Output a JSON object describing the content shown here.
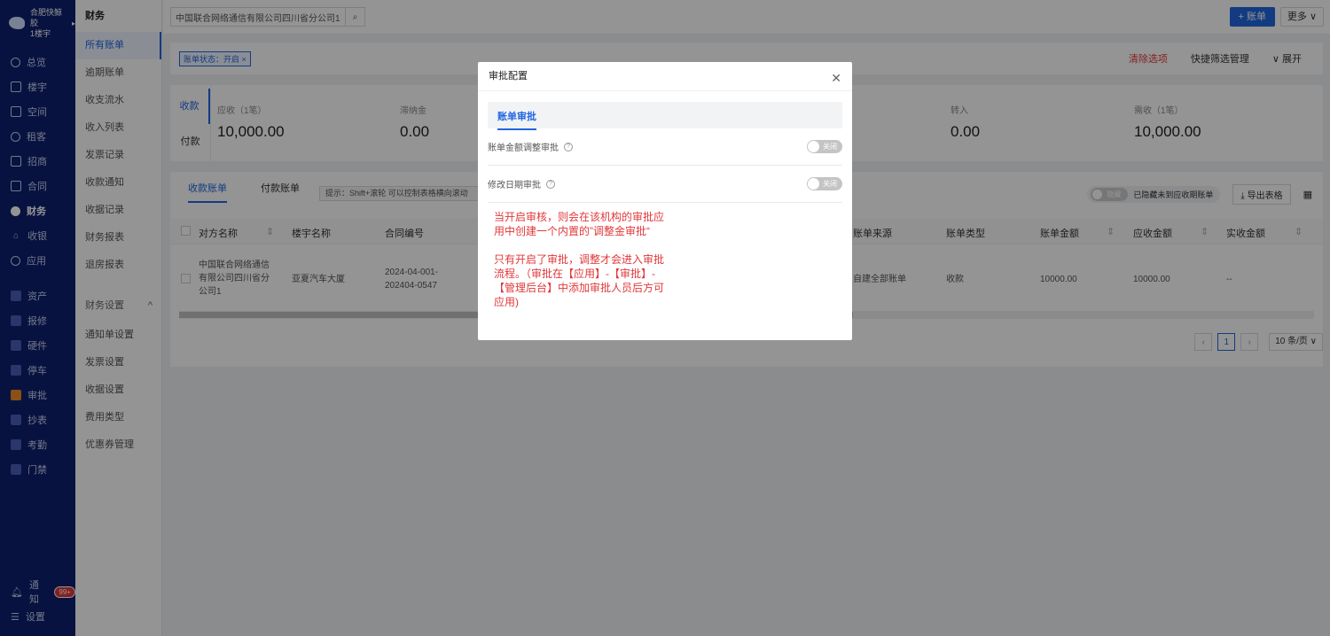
{
  "sidebar": {
    "org_name": "合肥快鲸胶",
    "org_sub": "1楼宇",
    "items": [
      {
        "label": "总览",
        "icon": "dashboard-icon"
      },
      {
        "label": "楼宇",
        "icon": "building-icon"
      },
      {
        "label": "空间",
        "icon": "cube-icon"
      },
      {
        "label": "租客",
        "icon": "user-icon"
      },
      {
        "label": "招商",
        "icon": "tag-icon"
      },
      {
        "label": "合同",
        "icon": "document-icon"
      },
      {
        "label": "财务",
        "icon": "finance-icon"
      },
      {
        "label": "收银",
        "icon": "house-icon"
      },
      {
        "label": "应用",
        "icon": "app-icon"
      }
    ],
    "apps": [
      {
        "label": "资产"
      },
      {
        "label": "报修"
      },
      {
        "label": "硬件"
      },
      {
        "label": "停车"
      },
      {
        "label": "审批"
      },
      {
        "label": "抄表"
      },
      {
        "label": "考勤"
      },
      {
        "label": "门禁"
      }
    ],
    "notify_label": "通知",
    "notify_badge": "99+",
    "settings_label": "设置"
  },
  "subnav": {
    "title": "财务",
    "items": [
      "所有账单",
      "逾期账单",
      "收支流水",
      "收入列表",
      "发票记录",
      "收款通知",
      "收据记录",
      "财务报表",
      "退房报表"
    ],
    "group_label": "财务设置",
    "group_items": [
      "通知单设置",
      "发票设置",
      "收据设置",
      "费用类型",
      "优惠券管理"
    ]
  },
  "topbar": {
    "search_value": "中国联合网络通信有限公司四川省分公司1",
    "add_label": "+ 账单",
    "more_label": "更多 ∨"
  },
  "filter": {
    "chip_label": "账单状态：开启 ×",
    "clear_label": "清除选项",
    "quick_label": "快捷筛选管理",
    "expand_label": "∨ 展开"
  },
  "stats": {
    "tab_in": "收款",
    "tab_out": "付款",
    "items": [
      {
        "label": "应收（1笔）",
        "value": "10,000.00"
      },
      {
        "label": "滞纳金",
        "value": "0.00"
      },
      {
        "label": "转入",
        "value": "0.00"
      },
      {
        "label": "需收（1笔）",
        "value": "10,000.00"
      }
    ]
  },
  "table": {
    "tabs": [
      "收款账单",
      "付款账单"
    ],
    "tip": "提示：Shift+滚轮 可以控制表格横向滚动",
    "hide_toggle": "隐藏",
    "hide_label": "已隐藏未到应收期账单",
    "export_label": "导出表格",
    "columns": [
      "对方名称",
      "楼宇名称",
      "合同编号",
      "账单来源",
      "账单类型",
      "账单金额",
      "应收金额",
      "实收金额"
    ],
    "row": {
      "party": "中国联合网络通信有限公司四川省分公司1",
      "building": "亚夏汽车大厦",
      "contract": "2024-04-001-202404-0547",
      "source": "自建全部账单",
      "type": "收款",
      "amount": "10000.00",
      "receivable": "10000.00",
      "received": "--"
    },
    "pager": {
      "page": "1",
      "size": "10 条/页 ∨"
    }
  },
  "modal": {
    "title": "审批配置",
    "tab": "账单审批",
    "settings": [
      {
        "label": "账单金额调整审批",
        "state": "关闭"
      },
      {
        "label": "修改日期审批",
        "state": "关闭"
      }
    ],
    "note1": "当开启审核，则会在该机构的审批应用中创建一个内置的”调整金审批“",
    "note2": "只有开启了审批，调整才会进入审批流程。（审批在【应用】-【审批】-【管理后台】中添加审批人员后方可应用)"
  }
}
